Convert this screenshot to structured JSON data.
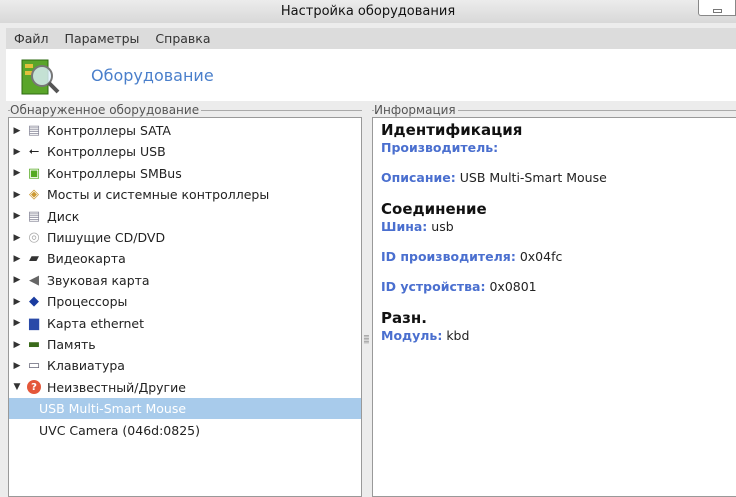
{
  "window": {
    "title": "Настройка оборудования"
  },
  "menu": [
    "Файл",
    "Параметры",
    "Справка"
  ],
  "header": {
    "title": "Оборудование"
  },
  "left": {
    "label": "Обнаруженное оборудование",
    "items": [
      {
        "label": "Контроллеры SATA",
        "icon": "disk-icon"
      },
      {
        "label": "Контроллеры USB",
        "icon": "usb-icon"
      },
      {
        "label": "Контроллеры SMBus",
        "icon": "hardware-search-icon"
      },
      {
        "label": "Мосты и системные контроллеры",
        "icon": "bridge-icon"
      },
      {
        "label": "Диск",
        "icon": "disk-icon"
      },
      {
        "label": "Пишущие CD/DVD",
        "icon": "cd-icon"
      },
      {
        "label": "Видеокарта",
        "icon": "video-card-icon"
      },
      {
        "label": "Звуковая карта",
        "icon": "speaker-icon"
      },
      {
        "label": "Процессоры",
        "icon": "cpu-icon"
      },
      {
        "label": "Карта ethernet",
        "icon": "network-icon"
      },
      {
        "label": "Память",
        "icon": "memory-icon"
      },
      {
        "label": "Клавиатура",
        "icon": "keyboard-icon"
      },
      {
        "label": "Неизвестный/Другие",
        "icon": "unknown-icon",
        "expanded": true
      }
    ],
    "children": [
      "USB Multi-Smart Mouse",
      "UVC Camera (046d:0825)"
    ],
    "selected": "USB Multi-Smart Mouse"
  },
  "right": {
    "label": "Информация",
    "s1": "Идентификация",
    "vendor_k": "Производитель:",
    "desc_k": "Описание:",
    "desc_v": "USB Multi-Smart Mouse",
    "s2": "Соединение",
    "bus_k": "Шина:",
    "bus_v": "usb",
    "vid_k": "ID производителя:",
    "vid_v": "0x04fc",
    "did_k": "ID устройства:",
    "did_v": "0x0801",
    "s3": "Разн.",
    "mod_k": "Модуль:",
    "mod_v": "kbd"
  }
}
